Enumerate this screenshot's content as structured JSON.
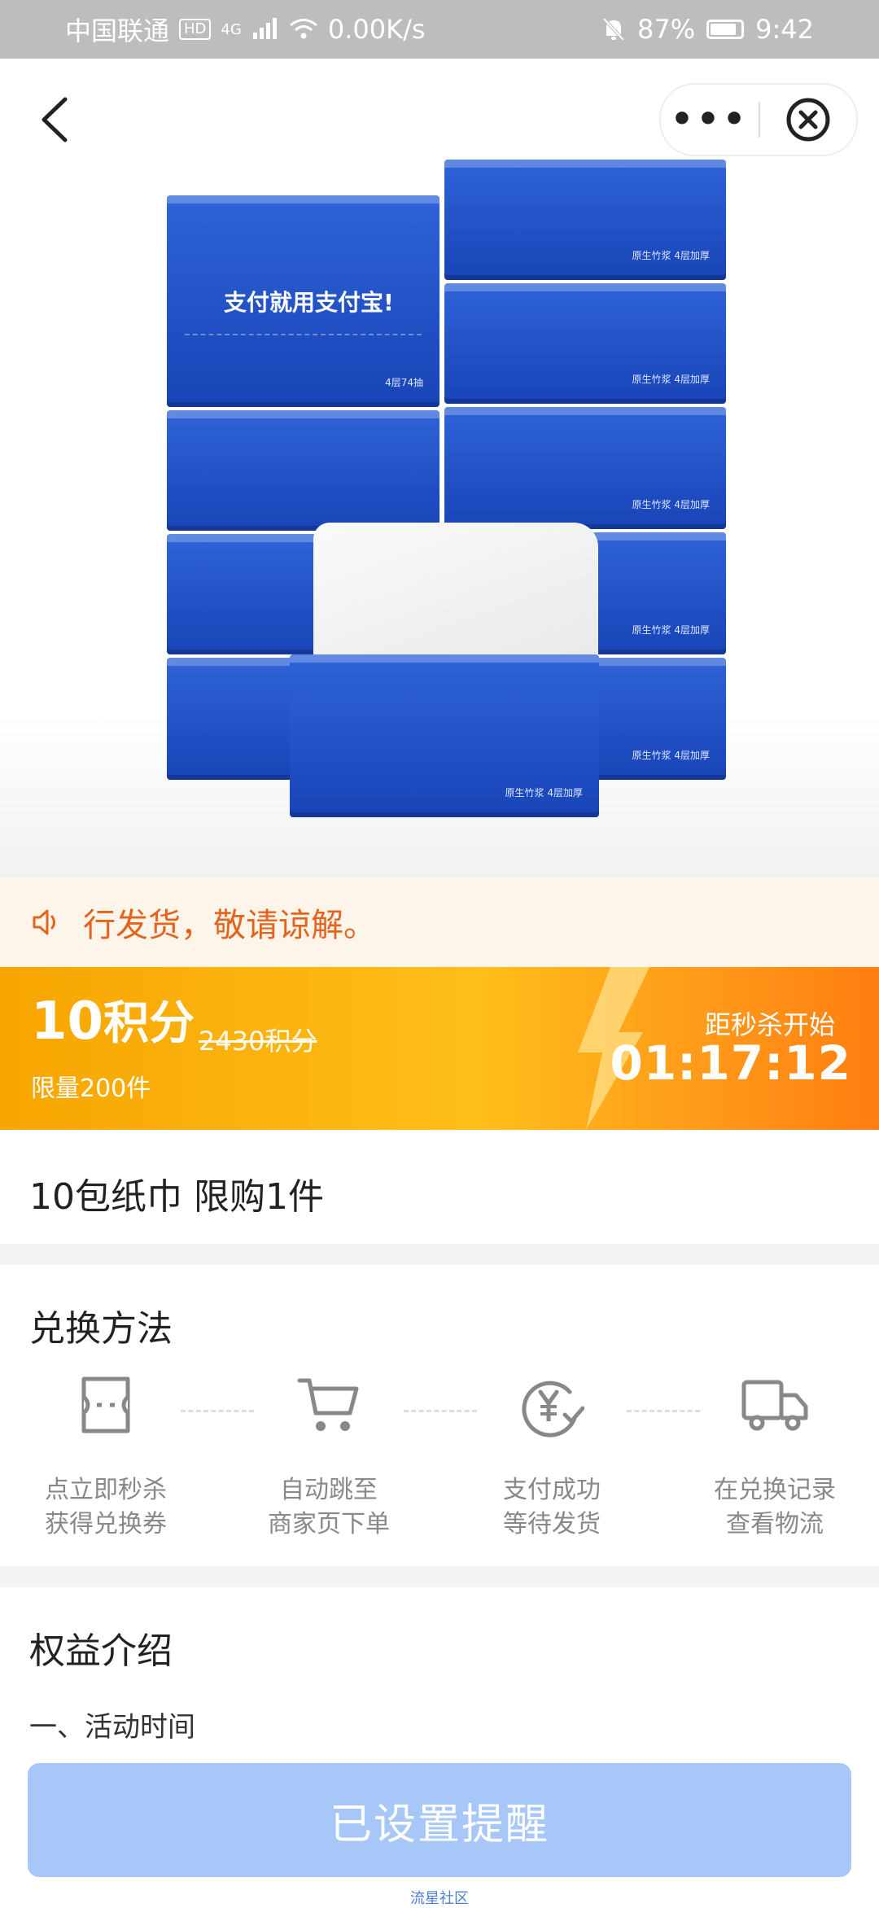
{
  "status_bar": {
    "carrier": "中国联通",
    "hd": "HD",
    "network": "4G",
    "speed": "0.00K/s",
    "battery": "87%",
    "battery_level": 0.87,
    "time": "9:42"
  },
  "product_image": {
    "slogan": "支付就用支付宝!",
    "pack_text_1": "4层74抽",
    "pack_text_2": "原生竹浆  4层加厚"
  },
  "notice": {
    "text": "行发货，敬请谅解。"
  },
  "flash_sale": {
    "price_value": "10",
    "price_unit": "积分",
    "original_price": "2430积分",
    "limit": "限量200件",
    "countdown_label": "距秒杀开始",
    "countdown": "01:17:12"
  },
  "product": {
    "title": "10包纸巾 限购1件"
  },
  "exchange": {
    "title": "兑换方法",
    "steps": [
      {
        "icon": "ticket-icon",
        "line1": "点立即秒杀",
        "line2": "获得兑换券"
      },
      {
        "icon": "cart-icon",
        "line1": "自动跳至",
        "line2": "商家页下单"
      },
      {
        "icon": "yuan-check-icon",
        "line1": "支付成功",
        "line2": "等待发货"
      },
      {
        "icon": "truck-icon",
        "line1": "在兑换记录",
        "line2": "查看物流"
      }
    ]
  },
  "benefits": {
    "title": "权益介绍",
    "item1": "一、活动时间"
  },
  "action": {
    "remind_label": "已设置提醒"
  },
  "footer": {
    "watermark": "流星社区"
  },
  "colors": {
    "accent_orange": "#f7a500",
    "notice_text": "#e5641d",
    "button_disabled": "#a6c7f8",
    "product_blue": "#2152c9"
  }
}
